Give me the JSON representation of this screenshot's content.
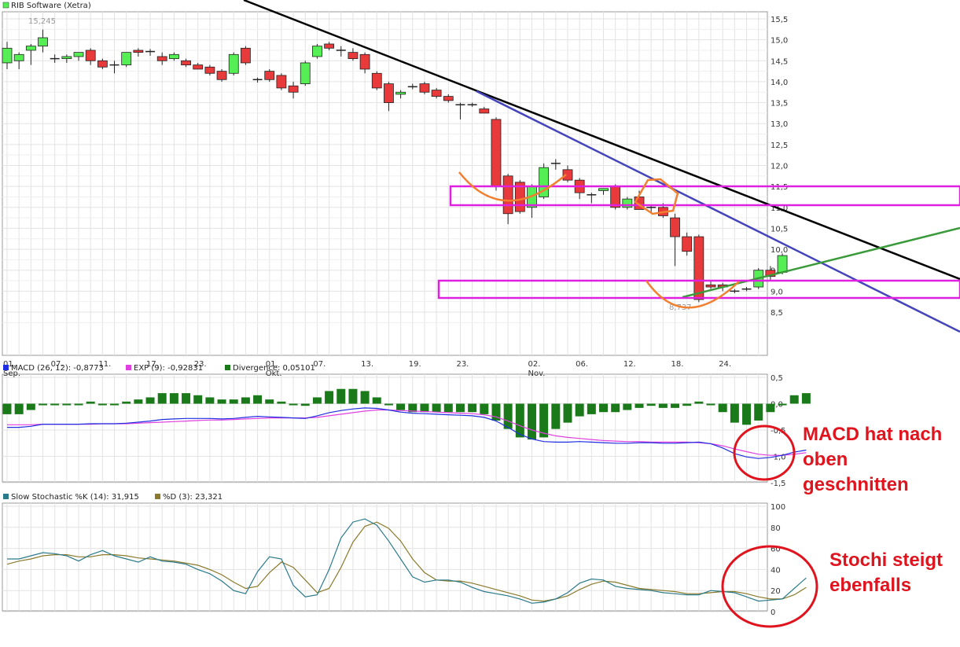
{
  "colors": {
    "up": "#55ee55",
    "down": "#e83a3a",
    "macd": "#1f2ee0",
    "signal": "#e040e0",
    "divergence": "#1a7a1a",
    "stoch_k": "#2b7a8a",
    "stoch_d": "#8a7a2b",
    "resistance_band": "#e020e0",
    "downtrend_black": "#000000",
    "downtrend_blue": "#4444bb",
    "uptrend_green": "#3a9a3a",
    "shape_orange": "#f08030",
    "annotation_red": "#e0141e"
  },
  "chart_data": [
    {
      "type": "candlestick",
      "legend": "RIB Software (Xetra)",
      "ylim": [
        8.1,
        15.65
      ],
      "yticks": [
        "15,5",
        "15,0",
        "14,5",
        "14,0",
        "13,5",
        "13,0",
        "12,5",
        "12,0",
        "11,5",
        "11,0",
        "10,5",
        "10,0",
        "9,5",
        "9,0",
        "8,5"
      ],
      "ytick_values": [
        15.5,
        15.0,
        14.5,
        14.0,
        13.5,
        13.0,
        12.5,
        12.0,
        11.5,
        11.0,
        10.5,
        10.0,
        9.5,
        9.0,
        8.5
      ],
      "xticks": [
        {
          "label": "01.",
          "sub": "Sep.",
          "index": 0
        },
        {
          "label": "07.",
          "sub": "",
          "index": 4
        },
        {
          "label": "11.",
          "sub": "",
          "index": 8
        },
        {
          "label": "17.",
          "sub": "",
          "index": 12
        },
        {
          "label": "23.",
          "sub": "",
          "index": 16
        },
        {
          "label": "01.",
          "sub": "Okt.",
          "index": 22
        },
        {
          "label": "07.",
          "sub": "",
          "index": 26
        },
        {
          "label": "13.",
          "sub": "",
          "index": 30
        },
        {
          "label": "19.",
          "sub": "",
          "index": 34
        },
        {
          "label": "23.",
          "sub": "",
          "index": 38
        },
        {
          "label": "02.",
          "sub": "Nov.",
          "index": 44
        },
        {
          "label": "06.",
          "sub": "",
          "index": 48
        },
        {
          "label": "12.",
          "sub": "",
          "index": 52
        },
        {
          "label": "18.",
          "sub": "",
          "index": 56
        },
        {
          "label": "24.",
          "sub": "",
          "index": 60
        }
      ],
      "max_label": "15,245",
      "min_label": "8,737",
      "candles": [
        {
          "o": 14.45,
          "h": 14.95,
          "l": 14.3,
          "c": 14.8
        },
        {
          "o": 14.5,
          "h": 14.7,
          "l": 14.3,
          "c": 14.65
        },
        {
          "o": 14.75,
          "h": 14.9,
          "l": 14.4,
          "c": 14.85
        },
        {
          "o": 14.85,
          "h": 15.245,
          "l": 14.7,
          "c": 15.05
        },
        {
          "o": 14.55,
          "h": 14.65,
          "l": 14.45,
          "c": 14.55
        },
        {
          "o": 14.55,
          "h": 14.65,
          "l": 14.45,
          "c": 14.6
        },
        {
          "o": 14.6,
          "h": 14.7,
          "l": 14.5,
          "c": 14.7
        },
        {
          "o": 14.75,
          "h": 14.8,
          "l": 14.4,
          "c": 14.5
        },
        {
          "o": 14.5,
          "h": 14.55,
          "l": 14.3,
          "c": 14.35
        },
        {
          "o": 14.4,
          "h": 14.5,
          "l": 14.2,
          "c": 14.4
        },
        {
          "o": 14.4,
          "h": 14.7,
          "l": 14.35,
          "c": 14.7
        },
        {
          "o": 14.75,
          "h": 14.8,
          "l": 14.6,
          "c": 14.7
        },
        {
          "o": 14.72,
          "h": 14.78,
          "l": 14.62,
          "c": 14.72
        },
        {
          "o": 14.6,
          "h": 14.7,
          "l": 14.4,
          "c": 14.5
        },
        {
          "o": 14.55,
          "h": 14.7,
          "l": 14.5,
          "c": 14.65
        },
        {
          "o": 14.5,
          "h": 14.55,
          "l": 14.35,
          "c": 14.4
        },
        {
          "o": 14.4,
          "h": 14.45,
          "l": 14.3,
          "c": 14.3
        },
        {
          "o": 14.35,
          "h": 14.4,
          "l": 14.15,
          "c": 14.2
        },
        {
          "o": 14.25,
          "h": 14.3,
          "l": 14.0,
          "c": 14.05
        },
        {
          "o": 14.2,
          "h": 14.7,
          "l": 14.15,
          "c": 14.65
        },
        {
          "o": 14.8,
          "h": 14.85,
          "l": 14.4,
          "c": 14.45
        },
        {
          "o": 14.05,
          "h": 14.1,
          "l": 13.98,
          "c": 14.05
        },
        {
          "o": 14.25,
          "h": 14.3,
          "l": 14.0,
          "c": 14.05
        },
        {
          "o": 14.15,
          "h": 14.2,
          "l": 13.8,
          "c": 13.85
        },
        {
          "o": 13.9,
          "h": 14.0,
          "l": 13.6,
          "c": 13.75
        },
        {
          "o": 13.95,
          "h": 14.5,
          "l": 13.9,
          "c": 14.45
        },
        {
          "o": 14.6,
          "h": 14.9,
          "l": 14.55,
          "c": 14.85
        },
        {
          "o": 14.9,
          "h": 14.95,
          "l": 14.75,
          "c": 14.8
        },
        {
          "o": 14.75,
          "h": 14.85,
          "l": 14.6,
          "c": 14.75
        },
        {
          "o": 14.7,
          "h": 14.8,
          "l": 14.5,
          "c": 14.55
        },
        {
          "o": 14.65,
          "h": 14.7,
          "l": 14.2,
          "c": 14.3
        },
        {
          "o": 14.2,
          "h": 14.25,
          "l": 13.8,
          "c": 13.85
        },
        {
          "o": 13.95,
          "h": 14.0,
          "l": 13.3,
          "c": 13.5
        },
        {
          "o": 13.7,
          "h": 13.8,
          "l": 13.6,
          "c": 13.75
        },
        {
          "o": 13.88,
          "h": 13.95,
          "l": 13.82,
          "c": 13.88
        },
        {
          "o": 13.95,
          "h": 14.0,
          "l": 13.7,
          "c": 13.75
        },
        {
          "o": 13.8,
          "h": 13.85,
          "l": 13.6,
          "c": 13.65
        },
        {
          "o": 13.65,
          "h": 13.7,
          "l": 13.5,
          "c": 13.55
        },
        {
          "o": 13.45,
          "h": 13.5,
          "l": 13.1,
          "c": 13.45
        },
        {
          "o": 13.45,
          "h": 13.5,
          "l": 13.4,
          "c": 13.45
        },
        {
          "o": 13.35,
          "h": 13.4,
          "l": 13.25,
          "c": 13.25
        },
        {
          "o": 13.1,
          "h": 13.15,
          "l": 11.4,
          "c": 11.5
        },
        {
          "o": 11.75,
          "h": 11.8,
          "l": 10.6,
          "c": 10.85
        },
        {
          "o": 11.6,
          "h": 11.65,
          "l": 10.85,
          "c": 10.9
        },
        {
          "o": 11.0,
          "h": 11.55,
          "l": 10.75,
          "c": 11.5
        },
        {
          "o": 11.25,
          "h": 12.05,
          "l": 11.2,
          "c": 11.95
        },
        {
          "o": 12.05,
          "h": 12.15,
          "l": 11.9,
          "c": 12.05
        },
        {
          "o": 11.9,
          "h": 12.0,
          "l": 11.6,
          "c": 11.65
        },
        {
          "o": 11.65,
          "h": 11.7,
          "l": 11.2,
          "c": 11.35
        },
        {
          "o": 11.3,
          "h": 11.35,
          "l": 11.1,
          "c": 11.3
        },
        {
          "o": 11.4,
          "h": 11.45,
          "l": 11.3,
          "c": 11.45
        },
        {
          "o": 11.5,
          "h": 11.55,
          "l": 10.95,
          "c": 11.0
        },
        {
          "o": 11.0,
          "h": 11.25,
          "l": 10.95,
          "c": 11.2
        },
        {
          "o": 11.25,
          "h": 11.4,
          "l": 10.95,
          "c": 10.95
        },
        {
          "o": 11.0,
          "h": 11.05,
          "l": 10.85,
          "c": 11.0
        },
        {
          "o": 11.0,
          "h": 11.1,
          "l": 10.75,
          "c": 10.8
        },
        {
          "o": 10.75,
          "h": 10.85,
          "l": 9.6,
          "c": 10.3
        },
        {
          "o": 10.3,
          "h": 10.4,
          "l": 9.85,
          "c": 9.95
        },
        {
          "o": 10.3,
          "h": 10.35,
          "l": 8.737,
          "c": 8.8
        },
        {
          "o": 9.15,
          "h": 9.25,
          "l": 9.05,
          "c": 9.1
        },
        {
          "o": 9.15,
          "h": 9.2,
          "l": 9.0,
          "c": 9.1
        },
        {
          "o": 9.0,
          "h": 9.05,
          "l": 8.95,
          "c": 9.0
        },
        {
          "o": 9.05,
          "h": 9.1,
          "l": 9.0,
          "c": 9.05
        },
        {
          "o": 9.1,
          "h": 9.55,
          "l": 9.05,
          "c": 9.5
        },
        {
          "o": 9.5,
          "h": 9.6,
          "l": 9.25,
          "c": 9.35
        },
        {
          "o": 9.45,
          "h": 9.9,
          "l": 9.4,
          "c": 9.85
        }
      ]
    },
    {
      "type": "line",
      "legend": [
        {
          "key": "macd",
          "label": "MACD (26, 12): -0,8773"
        },
        {
          "key": "exp",
          "label": "EXP (9): -0,92831"
        },
        {
          "key": "div",
          "label": "Divergence: 0,05101"
        }
      ],
      "ylim": [
        -1.5,
        0.5
      ],
      "yticks": [
        "0,5",
        "0,0",
        "-0,5",
        "-1,0",
        "-1,5"
      ],
      "ytick_values": [
        0.5,
        0.0,
        -0.5,
        -1.0,
        -1.5
      ],
      "macd": [
        -0.45,
        -0.45,
        -0.43,
        -0.39,
        -0.39,
        -0.39,
        -0.39,
        -0.38,
        -0.38,
        -0.38,
        -0.37,
        -0.35,
        -0.33,
        -0.3,
        -0.29,
        -0.28,
        -0.28,
        -0.28,
        -0.29,
        -0.28,
        -0.26,
        -0.24,
        -0.25,
        -0.26,
        -0.27,
        -0.28,
        -0.23,
        -0.17,
        -0.13,
        -0.1,
        -0.08,
        -0.09,
        -0.12,
        -0.16,
        -0.18,
        -0.19,
        -0.2,
        -0.21,
        -0.22,
        -0.23,
        -0.26,
        -0.33,
        -0.45,
        -0.58,
        -0.67,
        -0.72,
        -0.73,
        -0.73,
        -0.72,
        -0.73,
        -0.74,
        -0.75,
        -0.75,
        -0.74,
        -0.74,
        -0.75,
        -0.75,
        -0.74,
        -0.73,
        -0.76,
        -0.84,
        -0.95,
        -1.01,
        -1.04,
        -1.02,
        -0.98,
        -0.92,
        -0.88
      ],
      "exp": [
        -0.4,
        -0.4,
        -0.4,
        -0.39,
        -0.39,
        -0.39,
        -0.39,
        -0.39,
        -0.38,
        -0.38,
        -0.38,
        -0.37,
        -0.36,
        -0.35,
        -0.34,
        -0.33,
        -0.32,
        -0.31,
        -0.31,
        -0.3,
        -0.29,
        -0.28,
        -0.27,
        -0.27,
        -0.27,
        -0.27,
        -0.26,
        -0.23,
        -0.2,
        -0.17,
        -0.14,
        -0.12,
        -0.12,
        -0.13,
        -0.14,
        -0.15,
        -0.16,
        -0.17,
        -0.18,
        -0.19,
        -0.21,
        -0.25,
        -0.33,
        -0.42,
        -0.5,
        -0.56,
        -0.61,
        -0.64,
        -0.66,
        -0.68,
        -0.7,
        -0.71,
        -0.72,
        -0.72,
        -0.73,
        -0.73,
        -0.73,
        -0.73,
        -0.74,
        -0.76,
        -0.8,
        -0.86,
        -0.91,
        -0.96,
        -0.98,
        -0.98,
        -0.96,
        -0.93
      ],
      "divergence": [
        -0.05,
        -0.05,
        -0.03,
        0.0,
        0.0,
        0.0,
        0.0,
        0.01,
        0.0,
        0.0,
        0.01,
        0.02,
        0.03,
        0.05,
        0.05,
        0.05,
        0.04,
        0.03,
        0.02,
        0.02,
        0.03,
        0.04,
        0.02,
        0.01,
        0.0,
        -0.01,
        0.03,
        0.06,
        0.07,
        0.07,
        0.06,
        0.03,
        0.0,
        -0.03,
        -0.04,
        -0.04,
        -0.04,
        -0.04,
        -0.04,
        -0.04,
        -0.05,
        -0.08,
        -0.12,
        -0.16,
        -0.17,
        -0.16,
        -0.12,
        -0.09,
        -0.06,
        -0.05,
        -0.04,
        -0.04,
        -0.03,
        -0.02,
        -0.01,
        -0.02,
        -0.02,
        -0.01,
        0.01,
        0.0,
        -0.04,
        -0.09,
        -0.1,
        -0.08,
        -0.04,
        0.0,
        0.04,
        0.05
      ]
    },
    {
      "type": "line",
      "legend": [
        {
          "key": "k",
          "label": "Slow Stochastic %K (14): 31,915"
        },
        {
          "key": "d",
          "label": "%D (3): 23,321"
        }
      ],
      "ylim": [
        0,
        100
      ],
      "yticks": [
        "100",
        "80",
        "60",
        "40",
        "20",
        "0"
      ],
      "ytick_values": [
        100,
        80,
        60,
        40,
        20,
        0
      ],
      "k": [
        50,
        50,
        53,
        56,
        55,
        53,
        48,
        54,
        58,
        53,
        50,
        47,
        52,
        48,
        47,
        45,
        40,
        36,
        29,
        20,
        17,
        38,
        52,
        50,
        25,
        14,
        16,
        40,
        70,
        85,
        88,
        82,
        67,
        50,
        33,
        28,
        30,
        30,
        28,
        23,
        19,
        17,
        15,
        12,
        8,
        9,
        12,
        18,
        27,
        31,
        30,
        24,
        22,
        21,
        20,
        18,
        17,
        16,
        16,
        20,
        19,
        18,
        14,
        10,
        11,
        12,
        22,
        32
      ],
      "d": [
        45,
        48,
        50,
        53,
        54,
        54,
        52,
        52,
        54,
        54,
        53,
        51,
        50,
        49,
        48,
        46,
        44,
        40,
        35,
        28,
        22,
        24,
        37,
        47,
        42,
        30,
        18,
        22,
        42,
        66,
        81,
        85,
        79,
        67,
        50,
        37,
        30,
        29,
        29,
        27,
        24,
        21,
        18,
        15,
        11,
        10,
        12,
        15,
        21,
        26,
        29,
        28,
        25,
        22,
        21,
        20,
        19,
        17,
        17,
        18,
        19,
        19,
        17,
        14,
        12,
        12,
        16,
        23
      ]
    }
  ],
  "annotations": {
    "macd_note": [
      "MACD hat nach",
      "oben",
      "geschnitten"
    ],
    "stoch_note": [
      "Stochi steigt",
      "ebenfalls"
    ]
  }
}
